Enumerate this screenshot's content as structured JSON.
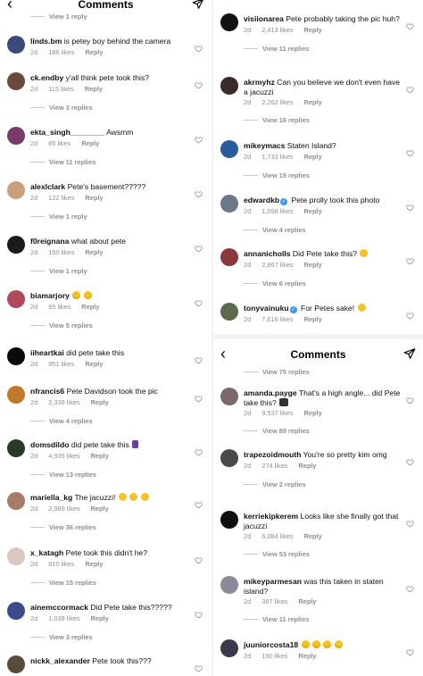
{
  "panels": [
    {
      "id": "left",
      "header": {
        "title": "Comments"
      },
      "top_view": "View 1 reply",
      "comments": [
        {
          "user": "linds.bm",
          "text": "is petey boy behind the camera",
          "age": "2d",
          "likes": "186 likes",
          "reply": "Reply",
          "view": "",
          "avatar": "#3b4a7a"
        },
        {
          "user": "ck.endby",
          "text": "y'all think pete took this?",
          "age": "2d",
          "likes": "115 likes",
          "reply": "Reply",
          "view": "View 3 replies",
          "avatar": "#6a4a3a"
        },
        {
          "user": "ekta_singh________",
          "text": "Awsmm",
          "age": "2d",
          "likes": "85 likes",
          "reply": "Reply",
          "view": "View 11 replies",
          "avatar": "#7a3a6a"
        },
        {
          "user": "alexlclark",
          "text": "Pete's basement?????",
          "age": "2d",
          "likes": "122 likes",
          "reply": "Reply",
          "view": "View 1 reply",
          "avatar": "#c9a07a"
        },
        {
          "user": "f0reignana",
          "text": "what about pete",
          "age": "2d",
          "likes": "150 likes",
          "reply": "Reply",
          "view": "View 1 reply",
          "avatar": "#1a1a1a"
        },
        {
          "user": "biamarjory",
          "text": "",
          "emojis": [
            "heart-eyes",
            "heart-eyes"
          ],
          "age": "2d",
          "likes": "95 likes",
          "reply": "Reply",
          "view": "View 5 replies",
          "avatar": "#b04a5a"
        },
        {
          "user": "iiheartkai",
          "text": "did pete take this",
          "age": "2d",
          "likes": "951 likes",
          "reply": "Reply",
          "view": "",
          "avatar": "#0a0a0a"
        },
        {
          "user": "nfrancis6",
          "text": "Pete Davidson took the pic",
          "age": "2d",
          "likes": "2,338 likes",
          "reply": "Reply",
          "view": "View 4 replies",
          "avatar": "#c07a2a"
        },
        {
          "user": "domsdildo",
          "text": "did pete take this",
          "emojis": [
            "man"
          ],
          "age": "2d",
          "likes": "4,935 likes",
          "reply": "Reply",
          "view": "View 13 replies",
          "avatar": "#2a3a2a"
        },
        {
          "user": "mariella_kg",
          "text": "The jacuzzi!",
          "emojis": [
            "laugh",
            "laugh",
            "laugh"
          ],
          "age": "2d",
          "likes": "2,989 likes",
          "reply": "Reply",
          "view": "View 36 replies",
          "avatar": "#a87a6a"
        },
        {
          "user": "x_katagh",
          "text": "Pete took this didn't he?",
          "age": "2d",
          "likes": "810 likes",
          "reply": "Reply",
          "view": "View 15 replies",
          "avatar": "#d8c8c0"
        },
        {
          "user": "ainemccormack",
          "text": "Did Pete take this?????",
          "age": "2d",
          "likes": "1,039 likes",
          "reply": "Reply",
          "view": "View 3 replies",
          "avatar": "#3a4a8a"
        },
        {
          "user": "nickk_alexander",
          "text": "Pete took this???",
          "age": "",
          "likes": "",
          "reply": "",
          "view": "",
          "avatar": "#5a4a3a"
        }
      ]
    },
    {
      "id": "right-a",
      "comments": [
        {
          "user": "visiionarea",
          "text": "Pete probably taking the pic huh?",
          "age": "2d",
          "likes": "2,413 likes",
          "reply": "Reply",
          "view": "View 11 replies",
          "avatar": "#111111"
        },
        {
          "user": "akrmyhz",
          "text": "Can you believe we don't even have a jacuzzi",
          "age": "2d",
          "likes": "2,262 likes",
          "reply": "Reply",
          "view": "View 16 replies",
          "avatar": "#3a2a2a"
        },
        {
          "user": "mikeymacs",
          "text": "Staten Island?",
          "age": "2d",
          "likes": "1,733 likes",
          "reply": "Reply",
          "view": "View 15 replies",
          "avatar": "#2a5aa0"
        },
        {
          "user": "edwardkb",
          "verified": true,
          "text": "Pete prolly took this photo",
          "age": "2d",
          "likes": "1,098 likes",
          "reply": "Reply",
          "view": "View 4 replies",
          "avatar": "#6a7a8a"
        },
        {
          "user": "annanicholls",
          "text": "Did Pete take this?",
          "emojis": [
            "laugh"
          ],
          "age": "2d",
          "likes": "2,867 likes",
          "reply": "Reply",
          "view": "View 6 replies",
          "avatar": "#8a3a3a"
        },
        {
          "user": "tonyvainuku",
          "verified": true,
          "text": "For Petes sake!",
          "emojis": [
            "laugh"
          ],
          "age": "2d",
          "likes": "7,616 likes",
          "reply": "Reply",
          "view": "",
          "avatar": "#5a6a4a"
        }
      ]
    },
    {
      "id": "right-b",
      "header": {
        "title": "Comments"
      },
      "top_view": "View 75 replies",
      "comments": [
        {
          "user": "amanda.payge",
          "text": "That's a high angle... did Pete take this?",
          "emojis": [
            "camera"
          ],
          "age": "2d",
          "likes": "9,537 likes",
          "reply": "Reply",
          "view": "View 89 replies",
          "avatar": "#7a6a6a"
        },
        {
          "user": "trapezoidmouth",
          "text": "You're so pretty kim omg",
          "age": "2d",
          "likes": "274 likes",
          "reply": "Reply",
          "view": "View 2 replies",
          "avatar": "#4a4a4a"
        },
        {
          "user": "kerriekipkerem",
          "text": "Looks like she finally got that jacuzzi",
          "age": "2d",
          "likes": "6,084 likes",
          "reply": "Reply",
          "view": "View 53 replies",
          "avatar": "#0f0f0f"
        },
        {
          "user": "mikeyparmesan",
          "text": "was this taken in staten island?",
          "age": "2d",
          "likes": "387 likes",
          "reply": "Reply",
          "view": "View 11 replies",
          "avatar": "#8a8a9a"
        },
        {
          "user": "juuniorcosta18",
          "text": "",
          "emojis": [
            "heart-eyes",
            "heart-eyes",
            "heart-eyes",
            "heart-eyes"
          ],
          "age": "2d",
          "likes": "190 likes",
          "reply": "Reply",
          "view": "",
          "avatar": "#3a3a4a"
        }
      ]
    }
  ],
  "colors": {
    "muted": "#8e8e8e",
    "verified": "#3797f0",
    "separator": "#f3f3f3"
  },
  "icons": {
    "back": "chevron-left-icon",
    "send": "paper-plane-icon",
    "like": "heart-outline-icon"
  }
}
